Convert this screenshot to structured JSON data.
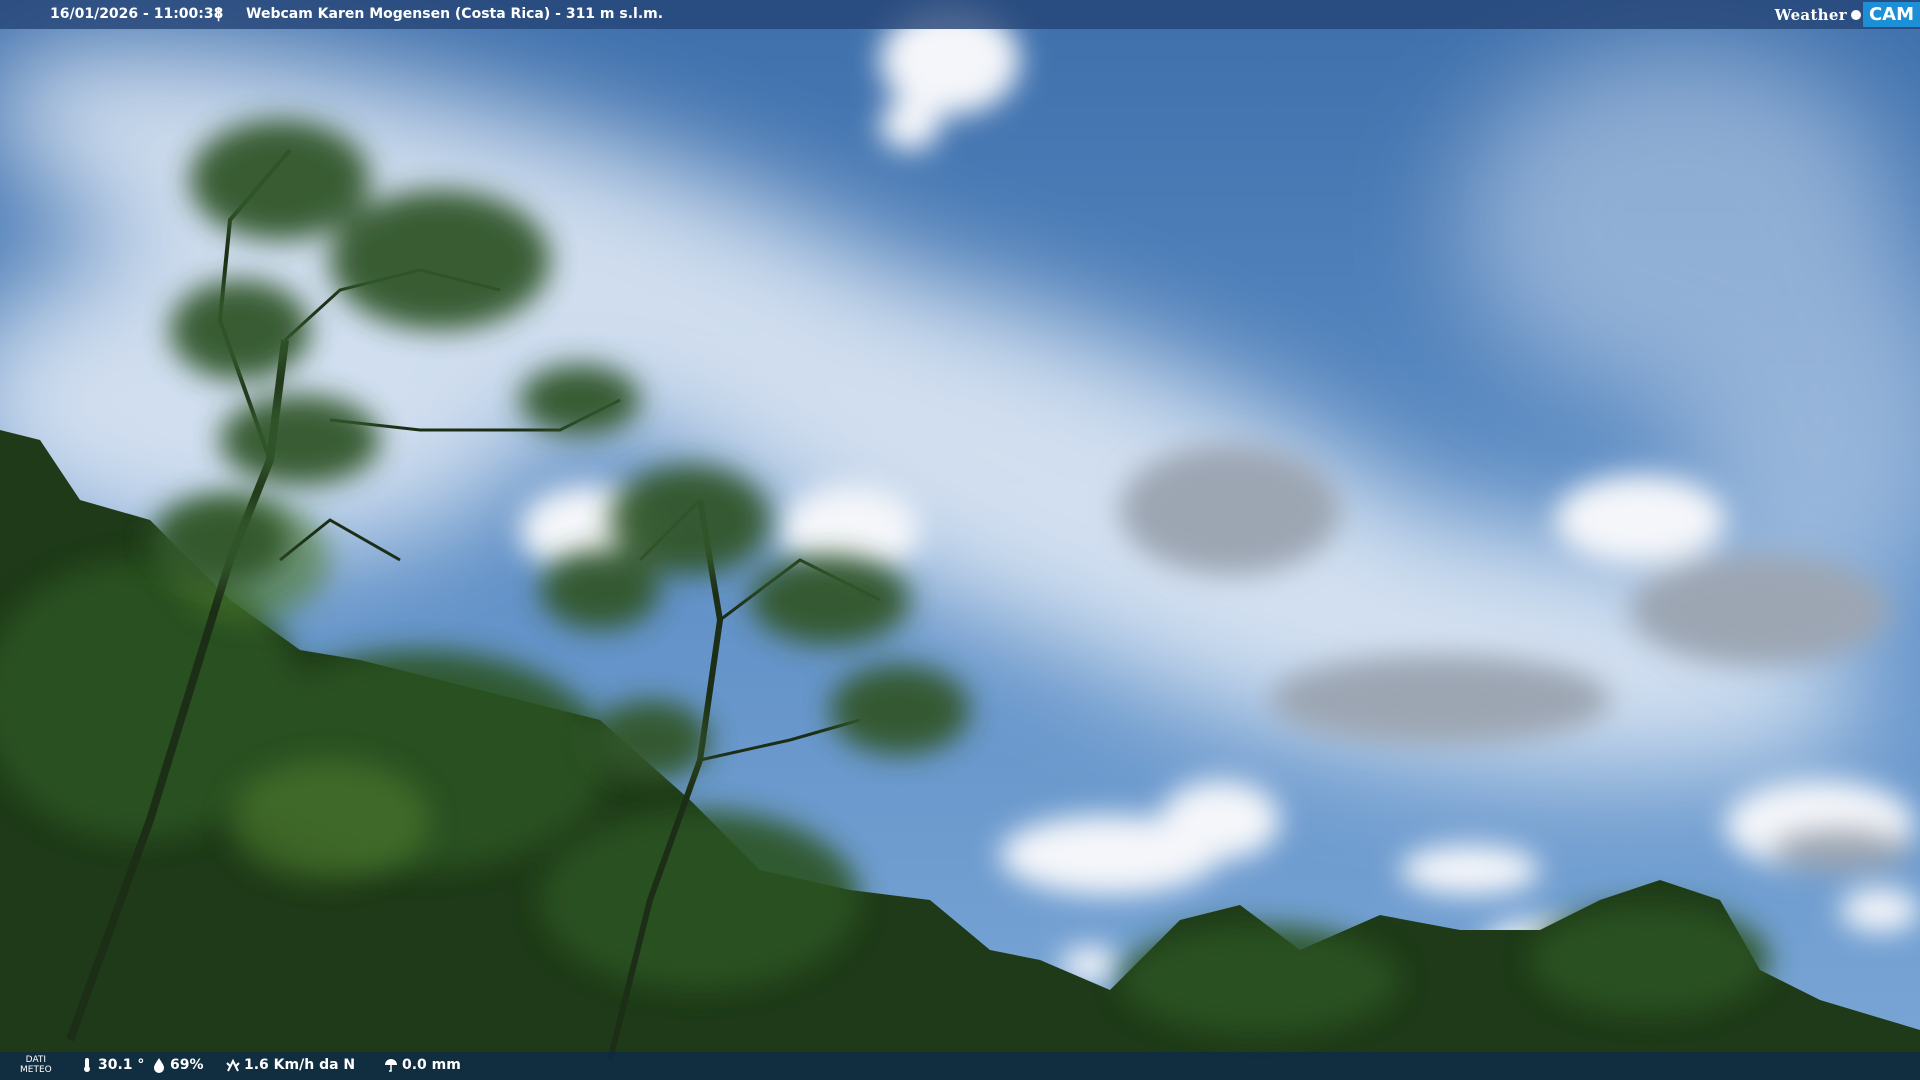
{
  "header": {
    "timestamp": "16/01/2026 - 11:00:38",
    "separator": "|",
    "camera_title": "Webcam Karen Mogensen (Costa Rica) - 311 m s.l.m."
  },
  "logo": {
    "word": "Weather",
    "cam": "CAM"
  },
  "footer": {
    "meteo_label_1": "DATI",
    "meteo_label_2": "METEO",
    "temperature": "30.1 °",
    "humidity": "69%",
    "wind": "1.6 Km/h da N",
    "rain": "0.0 mm"
  },
  "icons": {
    "temperature": "thermometer-icon",
    "humidity": "drop-icon",
    "wind": "wind-icon",
    "rain": "rain-gauge-icon"
  },
  "colors": {
    "sky": "#4f7fba",
    "bar": "#26467a",
    "logo_accent": "#1d8fd6",
    "foliage": "#1e3a18"
  }
}
